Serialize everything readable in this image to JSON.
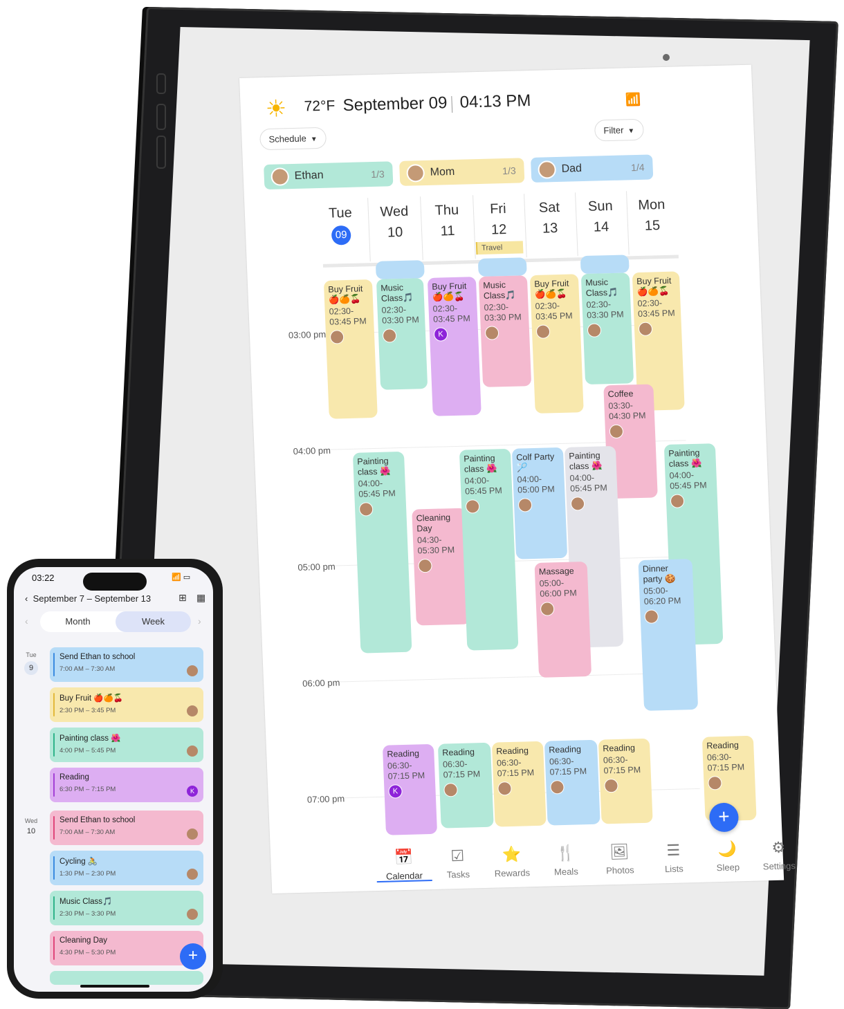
{
  "tablet": {
    "weather_icon": "sun-icon",
    "temperature": "72°F",
    "date": "September 09",
    "time": "04:13 PM",
    "wifi_icon": "wifi-icon",
    "view_selector": "Schedule",
    "filter_label": "Filter",
    "members": [
      {
        "name": "Ethan",
        "count": "1/3",
        "color": "#b2e8d8"
      },
      {
        "name": "Mom",
        "count": "1/3",
        "color": "#f8e8ad"
      },
      {
        "name": "Dad",
        "count": "1/4",
        "color": "#b7dcf7"
      }
    ],
    "days": [
      {
        "dow": "Tue",
        "num": "09",
        "today": true
      },
      {
        "dow": "Wed",
        "num": "10"
      },
      {
        "dow": "Thu",
        "num": "11"
      },
      {
        "dow": "Fri",
        "num": "12"
      },
      {
        "dow": "Sat",
        "num": "13"
      },
      {
        "dow": "Sun",
        "num": "14"
      },
      {
        "dow": "Mon",
        "num": "15"
      }
    ],
    "all_day_event": "Travel",
    "time_labels": [
      "03:00 pm",
      "04:00 pm",
      "05:00 pm",
      "06:00 pm",
      "07:00 pm"
    ],
    "events": {
      "buy_fruit": {
        "title": "Buy Fruit 🍎🍊🍒",
        "time": "02:30-03:45 PM"
      },
      "music_class": {
        "title": "Music Class🎵",
        "time": "02:30-03:30 PM"
      },
      "coffee": {
        "title": "Coffee",
        "time": "03:30-04:30 PM"
      },
      "painting_class": {
        "title": "Painting class 🌺",
        "time": "04:00-05:45 PM"
      },
      "golf_party": {
        "title": "Colf Party 🏸",
        "time": "04:00-05:00 PM"
      },
      "cleaning_day": {
        "title": "Cleaning Day",
        "time": "04:30-05:30 PM"
      },
      "massage": {
        "title": "Massage",
        "time": "05:00-06:00 PM"
      },
      "dinner_party": {
        "title": "Dinner party 🍪",
        "time": "05:00-06:20 PM"
      },
      "reading": {
        "title": "Reading",
        "time": "06:30-07:15 PM"
      },
      "avatar_letter": "K"
    },
    "nav": [
      {
        "label": "Calendar",
        "icon": "calendar-icon",
        "active": true
      },
      {
        "label": "Tasks",
        "icon": "tasks-icon"
      },
      {
        "label": "Rewards",
        "icon": "star-icon"
      },
      {
        "label": "Meals",
        "icon": "utensils-icon"
      },
      {
        "label": "Photos",
        "icon": "photos-icon"
      },
      {
        "label": "Lists",
        "icon": "list-icon"
      },
      {
        "label": "Sleep",
        "icon": "moon-icon"
      },
      {
        "label": "Settings",
        "icon": "gear-icon"
      }
    ],
    "add_label": "+"
  },
  "phone": {
    "clock": "03:22",
    "range": "September 7 – September 13",
    "tabs": {
      "month": "Month",
      "week": "Week"
    },
    "days": [
      {
        "dow": "Tue",
        "num": "9"
      },
      {
        "dow": "Wed",
        "num": "10"
      }
    ],
    "events": [
      {
        "title": "Send Ethan to school",
        "time": "7:00 AM – 7:30 AM",
        "color": "#b7dcf7",
        "bar": "#3a8be0"
      },
      {
        "title": "Buy Fruit 🍎🍊🍒",
        "time": "2:30 PM – 3:45 PM",
        "color": "#f8e8ad",
        "bar": "#e2b93b"
      },
      {
        "title": "Painting class 🌺",
        "time": "4:00 PM – 5:45 PM",
        "color": "#b2e8d8",
        "bar": "#2fb38a"
      },
      {
        "title": "Reading",
        "time": "6:30 PM – 7:15 PM",
        "color": "#ddaef2",
        "bar": "#a340d6"
      },
      {
        "title": "Send Ethan to school",
        "time": "7:00 AM – 7:30 AM",
        "color": "#f4b9cf",
        "bar": "#e0457a"
      },
      {
        "title": "Cycling 🚴",
        "time": "1:30 PM – 2:30 PM",
        "color": "#b7dcf7",
        "bar": "#3a8be0"
      },
      {
        "title": "Music Class🎵",
        "time": "2:30 PM – 3:30 PM",
        "color": "#b2e8d8",
        "bar": "#2fb38a"
      },
      {
        "title": "Cleaning Day",
        "time": "4:30 PM – 5:30 PM",
        "color": "#f4b9cf",
        "bar": "#e0457a"
      }
    ],
    "avatar_letter": "K",
    "add_label": "+"
  }
}
